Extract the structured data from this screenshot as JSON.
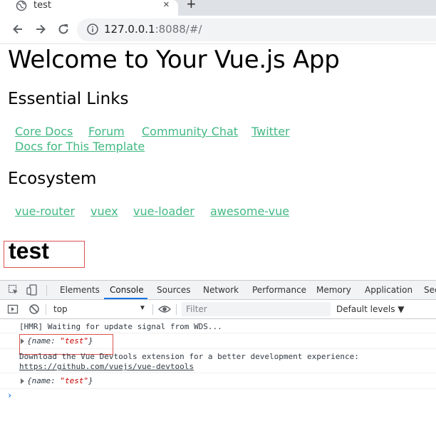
{
  "browser": {
    "tab_title": "test",
    "tab_close": "×",
    "new_tab": "+",
    "url_host": "127.0.0.1",
    "url_rest": ":8088/#/"
  },
  "page": {
    "title": "Welcome to Your Vue.js App",
    "essential_heading": "Essential Links",
    "essential_links": [
      "Core Docs",
      "Forum",
      "Community Chat",
      "Twitter",
      "Docs for This Template"
    ],
    "ecosystem_heading": "Ecosystem",
    "ecosystem_links": [
      "vue-router",
      "vuex",
      "vue-loader",
      "awesome-vue"
    ],
    "test_heading": "test",
    "link_color": "#42b983"
  },
  "devtools": {
    "tabs": [
      "Elements",
      "Console",
      "Sources",
      "Network",
      "Performance",
      "Memory",
      "Application",
      "Sec"
    ],
    "active_tab": "Console",
    "context": "top",
    "filter_placeholder": "Filter",
    "levels": "Default levels ▼",
    "messages": {
      "hmr": "[HMR] Waiting for update signal from WDS...",
      "obj1_key": "name",
      "obj1_value": "\"test\"",
      "devtools_notice": "Download the Vue Devtools extension for a better development experience:",
      "devtools_link": "https://github.com/vuejs/vue-devtools",
      "obj2_key": "name",
      "obj2_value": "\"test\""
    },
    "prompt": "›"
  },
  "colors": {
    "accent": "#1a73e8",
    "highlight_box": "#d9534f",
    "string_value": "#c80000"
  }
}
